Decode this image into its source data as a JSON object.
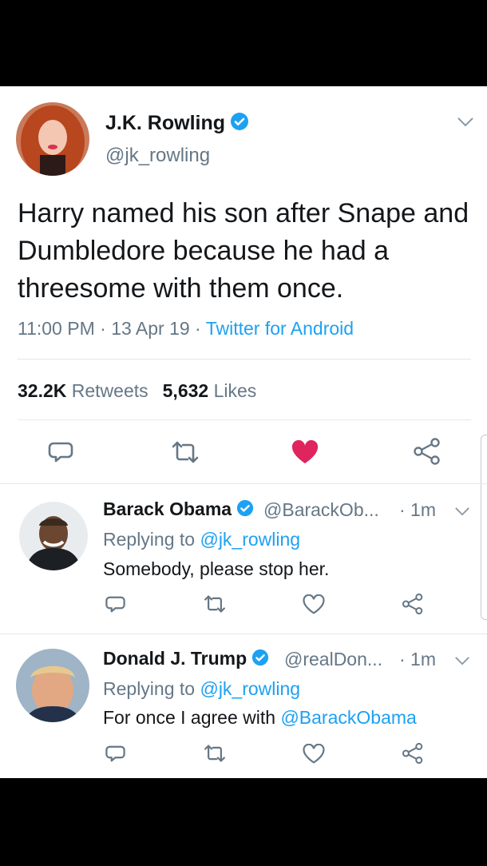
{
  "main_tweet": {
    "name": "J.K. Rowling",
    "handle": "@jk_rowling",
    "text": "Harry named his son after Snape and Dumbledore because he had a threesome with them once.",
    "time": "11:00 PM",
    "sep1": " · ",
    "date": "13 Apr 19",
    "sep2": " · ",
    "source": "Twitter for Android",
    "retweets_count": "32.2K",
    "retweets_label": "Retweets",
    "likes_count": "5,632",
    "likes_label": "Likes",
    "liked": true
  },
  "replies": [
    {
      "name": "Barack Obama",
      "handle": "@BarackOb...",
      "time": "· 1m",
      "replying_prefix": "Replying to ",
      "replying_to": "@jk_rowling",
      "text": "Somebody, please stop her.",
      "text_mention": ""
    },
    {
      "name": "Donald J. Trump",
      "handle": "@realDon...",
      "time": "· 1m",
      "replying_prefix": "Replying to ",
      "replying_to": "@jk_rowling",
      "text": "For once I agree with ",
      "text_mention": "@BarackObama"
    }
  ],
  "icons": [
    "verified-icon",
    "chevron-down-icon",
    "reply-icon",
    "retweet-icon",
    "heart-icon",
    "share-icon"
  ],
  "colors": {
    "accent": "#1da1f2",
    "like": "#e0245e",
    "muted": "#657786",
    "text": "#14171a"
  }
}
